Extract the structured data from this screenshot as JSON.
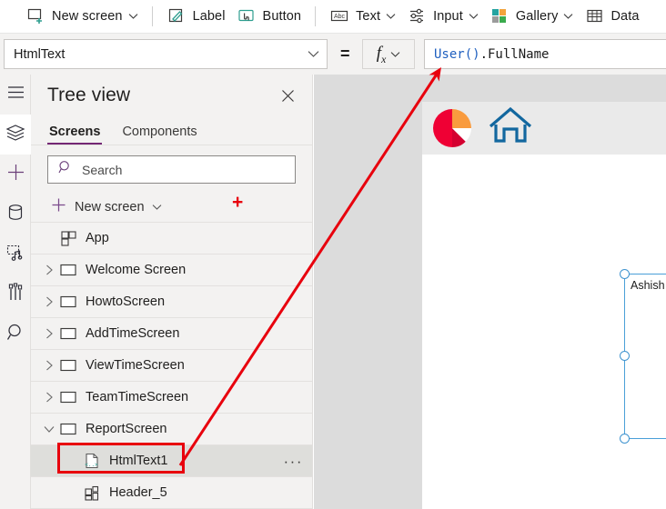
{
  "command_bar": {
    "items": [
      {
        "label": "New screen",
        "icon": "new-screen-icon",
        "has_chevron": true
      },
      {
        "label": "Label",
        "icon": "label-pencil-icon",
        "has_chevron": false
      },
      {
        "label": "Button",
        "icon": "button-cursor-icon",
        "has_chevron": false
      },
      {
        "label": "Text",
        "icon": "text-abc-icon",
        "has_chevron": true
      },
      {
        "label": "Input",
        "icon": "input-sliders-icon",
        "has_chevron": true
      },
      {
        "label": "Gallery",
        "icon": "gallery-grid-icon",
        "has_chevron": true
      },
      {
        "label": "Data",
        "icon": "data-table-icon",
        "has_chevron": false
      }
    ]
  },
  "formula_bar": {
    "property_selected": "HtmlText",
    "equals_sign": "=",
    "fx_label": "fx",
    "formula_function": "User()",
    "formula_rest": ".FullName",
    "intellisense": {
      "expression": "User().FullName",
      "equals": "=",
      "result": "Ashish Jaiswal"
    }
  },
  "left_rail": {
    "items": [
      {
        "name": "hamburger-menu-icon",
        "label": "Menu",
        "active": false
      },
      {
        "name": "tree-view-icon",
        "label": "Tree view",
        "active": true
      },
      {
        "name": "insert-plus-icon",
        "label": "Insert",
        "active": false
      },
      {
        "name": "data-cylinder-icon",
        "label": "Data",
        "active": false
      },
      {
        "name": "media-icon",
        "label": "Media",
        "active": false
      },
      {
        "name": "advanced-settings-icon",
        "label": "Advanced",
        "active": false
      },
      {
        "name": "search-magnifier-icon",
        "label": "Search",
        "active": false
      }
    ]
  },
  "tree_view": {
    "title": "Tree view",
    "close_label": "✕",
    "tabs": [
      {
        "label": "Screens",
        "selected": true
      },
      {
        "label": "Components",
        "selected": false
      }
    ],
    "search_placeholder": "Search",
    "new_screen": {
      "label": "New screen"
    },
    "rows": [
      {
        "label": "App",
        "icon": "app-icon",
        "level": "app",
        "twisty": "none",
        "selected": false,
        "dots": false
      },
      {
        "label": "Welcome Screen",
        "icon": "screen-icon",
        "level": "screen",
        "twisty": "collapsed",
        "selected": false,
        "dots": false
      },
      {
        "label": "HowtoScreen",
        "icon": "screen-icon",
        "level": "screen",
        "twisty": "collapsed",
        "selected": false,
        "dots": false
      },
      {
        "label": "AddTimeScreen",
        "icon": "screen-icon",
        "level": "screen",
        "twisty": "collapsed",
        "selected": false,
        "dots": false
      },
      {
        "label": "ViewTimeScreen",
        "icon": "screen-icon",
        "level": "screen",
        "twisty": "collapsed",
        "selected": false,
        "dots": false
      },
      {
        "label": "TeamTimeScreen",
        "icon": "screen-icon",
        "level": "screen",
        "twisty": "collapsed",
        "selected": false,
        "dots": false
      },
      {
        "label": "ReportScreen",
        "icon": "screen-icon",
        "level": "screen",
        "twisty": "expanded",
        "selected": false,
        "dots": false
      },
      {
        "label": "HtmlText1",
        "icon": "html-text-icon",
        "level": "child",
        "twisty": "none",
        "selected": true,
        "dots": true
      },
      {
        "label": "Header_5",
        "icon": "component-icon",
        "level": "child",
        "twisty": "none",
        "selected": false,
        "dots": false
      }
    ],
    "overflow_dots": "···"
  },
  "canvas": {
    "header_icons": [
      {
        "name": "pie-chart-icon"
      },
      {
        "name": "home-icon"
      }
    ],
    "selected_control": {
      "name": "HtmlText1",
      "rendered_text": "Ashish Jaiswal"
    }
  },
  "annotations": {
    "plus_marker": "+",
    "arrow": "red-arrow-from-htmltext1-to-formula-bar",
    "highlight_box": "red-rectangle-around-htmltext1"
  },
  "colors": {
    "accent_purple": "#742774",
    "annotation_red": "#e8000d",
    "selection_blue": "#3f93cf",
    "formula_blue": "#1f5fbf",
    "panel_gray": "#f3f2f1",
    "canvas_gray": "#dcdcdc",
    "teal_icon": "#2e9e8f",
    "home_blue": "#12679f"
  }
}
